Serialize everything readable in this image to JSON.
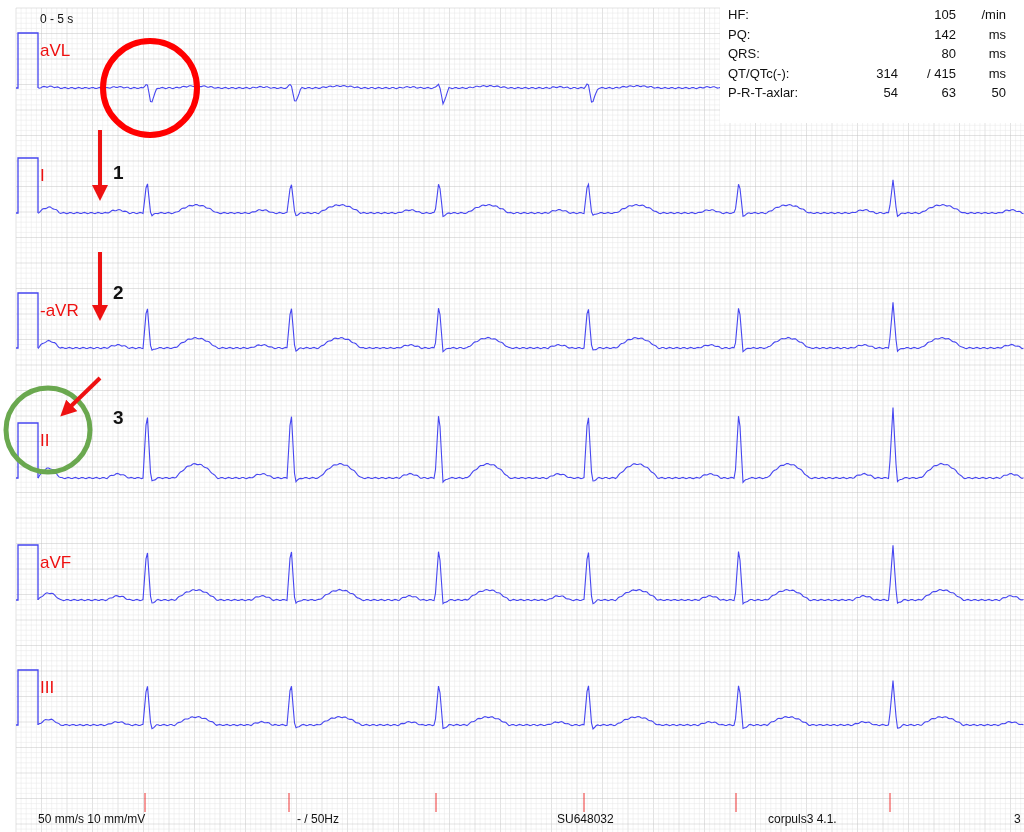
{
  "time_range": "0 - 5 s",
  "leads": [
    {
      "label": "aVL"
    },
    {
      "label": "I"
    },
    {
      "label": "-aVR"
    },
    {
      "label": "II"
    },
    {
      "label": "aVF"
    },
    {
      "label": "III"
    }
  ],
  "measurements": [
    {
      "label": "HF:",
      "column_3": "105",
      "column_4": "/min"
    },
    {
      "label": "PQ:",
      "column_3": "142",
      "column_4": "ms"
    },
    {
      "label": "QRS:",
      "column_3": "80",
      "column_4": "ms"
    },
    {
      "label": "QT/QTc(-):",
      "column_2": "314",
      "column_3": "/ 415",
      "column_4": "ms"
    },
    {
      "label": "P-R-T-axlar:",
      "column_2": "54",
      "column_3": "63",
      "column_4": "50"
    }
  ],
  "circles": [
    {
      "color": "#ff0000"
    },
    {
      "color": "#6aa84f"
    }
  ],
  "arrows": [
    {
      "number": "1"
    },
    {
      "number": "2"
    },
    {
      "number": "3"
    }
  ],
  "footer": [
    "50 mm/s 10 mm/mV",
    "- / 50Hz",
    "SU648032",
    "corpuls3 4.1.",
    "3"
  ]
}
